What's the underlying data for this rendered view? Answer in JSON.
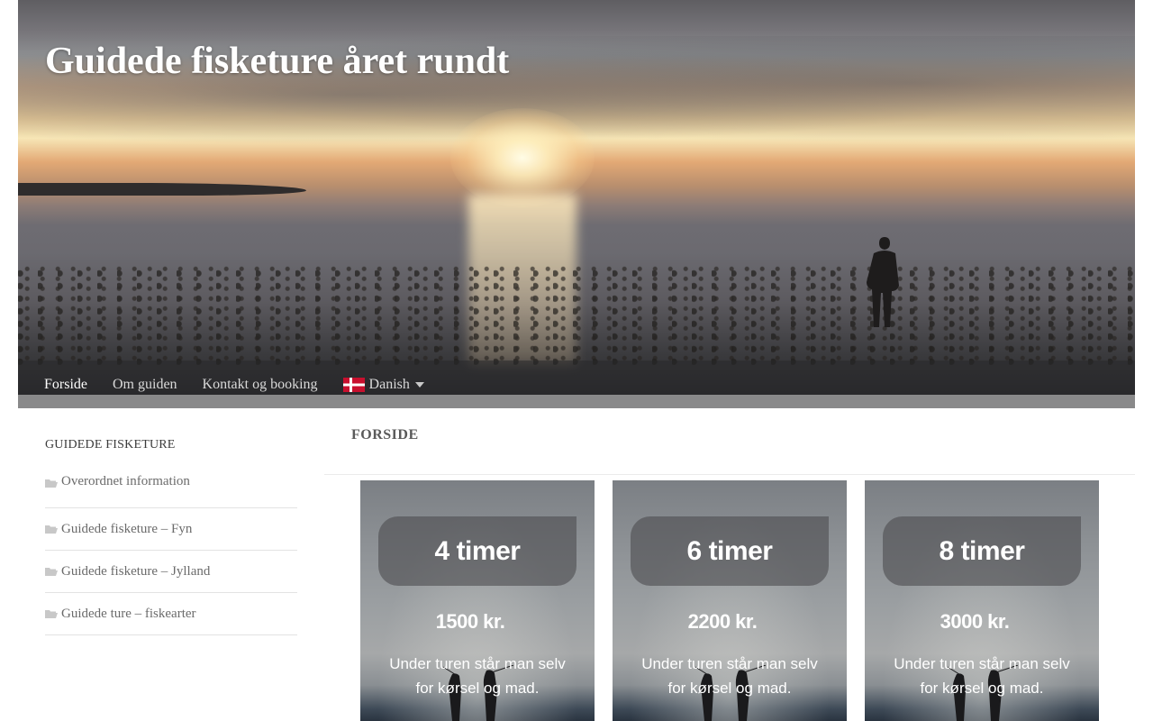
{
  "site": {
    "title": "Guidede fisketure året rundt"
  },
  "nav": {
    "items": [
      {
        "label": "Forside",
        "active": true
      },
      {
        "label": "Om guiden",
        "active": false
      },
      {
        "label": "Kontakt og booking",
        "active": false
      }
    ],
    "language": {
      "label": "Danish",
      "icon": "flag-denmark-icon"
    }
  },
  "sidebar": {
    "title": "GUIDEDE FISKETURE",
    "items": [
      {
        "label": "Overordnet information",
        "icon": "folder-icon"
      },
      {
        "label": "Guidede fisketure – Fyn",
        "icon": "folder-icon"
      },
      {
        "label": "Guidede fisketure – Jylland",
        "icon": "folder-icon"
      },
      {
        "label": "Guidede ture – fiskearter",
        "icon": "folder-icon"
      }
    ]
  },
  "main": {
    "heading": "FORSIDE",
    "cards": [
      {
        "duration": "4 timer",
        "price": "1500 kr.",
        "description": "Under turen står man selv for kørsel og mad."
      },
      {
        "duration": "6 timer",
        "price": "2200 kr.",
        "description": "Under turen står man selv for kørsel og mad."
      },
      {
        "duration": "8 timer",
        "price": "3000 kr.",
        "description": "Under turen står man selv for kørsel og mad."
      }
    ]
  },
  "colors": {
    "flag_red": "#c8102e",
    "flag_white": "#ffffff",
    "nav_text": "#d9d9d9",
    "card_text": "#ffffff"
  }
}
